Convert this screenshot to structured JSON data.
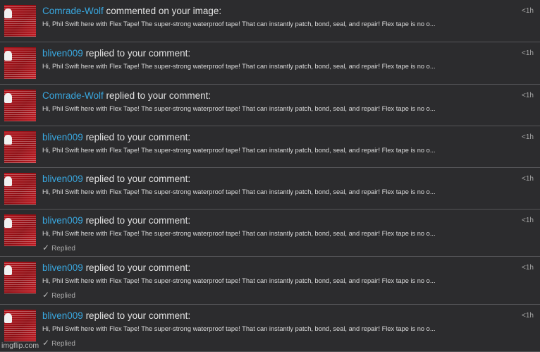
{
  "notifications": [
    {
      "user": "Comrade-Wolf",
      "action": "commented on your image:",
      "message": "Hi, Phil Swift here with Flex Tape! The super-strong waterproof tape! That can instantly patch, bond, seal, and repair! Flex tape is no o...",
      "time": "<1h",
      "replied": ""
    },
    {
      "user": "bliven009",
      "action": "replied to your comment:",
      "message": "Hi, Phil Swift here with Flex Tape! The super-strong waterproof tape! That can instantly patch, bond, seal, and repair! Flex tape is no o...",
      "time": "<1h",
      "replied": ""
    },
    {
      "user": "Comrade-Wolf",
      "action": "replied to your comment:",
      "message": "Hi, Phil Swift here with Flex Tape! The super-strong waterproof tape! That can instantly patch, bond, seal, and repair! Flex tape is no o...",
      "time": "<1h",
      "replied": ""
    },
    {
      "user": "bliven009",
      "action": "replied to your comment:",
      "message": "Hi, Phil Swift here with Flex Tape! The super-strong waterproof tape! That can instantly patch, bond, seal, and repair! Flex tape is no o...",
      "time": "<1h",
      "replied": ""
    },
    {
      "user": "bliven009",
      "action": "replied to your comment:",
      "message": "Hi, Phil Swift here with Flex Tape! The super-strong waterproof tape! That can instantly patch, bond, seal, and repair! Flex tape is no o...",
      "time": "<1h",
      "replied": ""
    },
    {
      "user": "bliven009",
      "action": "replied to your comment:",
      "message": "Hi, Phil Swift here with Flex Tape! The super-strong waterproof tape! That can instantly patch, bond, seal, and repair! Flex tape is no o...",
      "time": "<1h",
      "replied": "Replied"
    },
    {
      "user": "bliven009",
      "action": "replied to your comment:",
      "message": "Hi, Phil Swift here with Flex Tape! The super-strong waterproof tape! That can instantly patch, bond, seal, and repair! Flex tape is no o...",
      "time": "<1h",
      "replied": "Replied"
    },
    {
      "user": "bliven009",
      "action": "replied to your comment:",
      "message": "Hi, Phil Swift here with Flex Tape! The super-strong waterproof tape! That can instantly patch, bond, seal, and repair! Flex tape is no o...",
      "time": "<1h",
      "replied": "Replied"
    }
  ],
  "watermark": "imgflip.com",
  "colors": {
    "background": "#2c2c2e",
    "username": "#39a8e0",
    "divider": "#555558",
    "avatar": "#b3121a"
  },
  "icons": {
    "avatar": "user-avatar-icon",
    "replied": "check-icon"
  }
}
